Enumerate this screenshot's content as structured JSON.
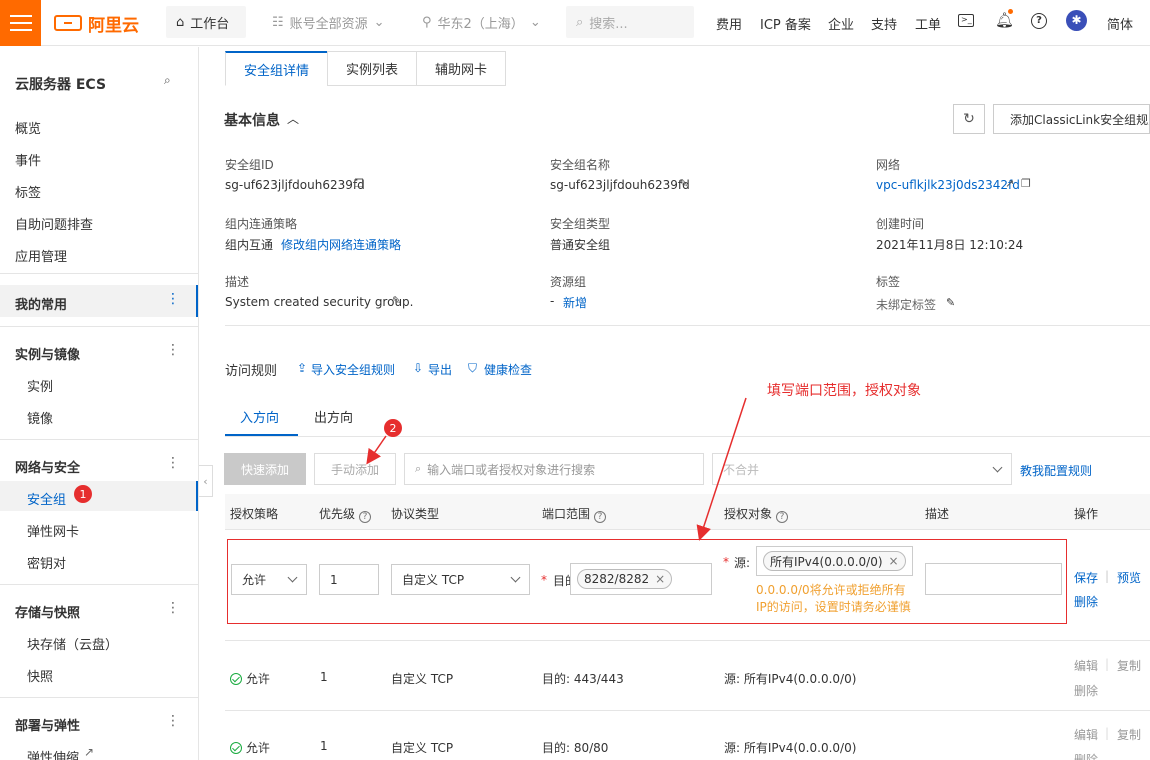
{
  "topbar": {
    "logo": "阿里云",
    "workbench": "工作台",
    "account": "账号全部资源",
    "region": "华东2（上海）",
    "search_placeholder": "搜索...",
    "nav": [
      "费用",
      "ICP 备案",
      "企业",
      "支持",
      "工单"
    ],
    "lang": "简体"
  },
  "sidebar": {
    "title": "云服务器 ECS",
    "items": [
      "概览",
      "事件",
      "标签",
      "自助问题排查",
      "应用管理"
    ],
    "favorites": "我的常用",
    "groups": [
      {
        "title": "实例与镜像",
        "items": [
          "实例",
          "镜像"
        ]
      },
      {
        "title": "网络与安全",
        "items": [
          "安全组",
          "弹性网卡",
          "密钥对"
        ]
      },
      {
        "title": "存储与快照",
        "items": [
          "块存储（云盘）",
          "快照"
        ]
      },
      {
        "title": "部署与弹性",
        "items": [
          "弹性伸缩"
        ]
      }
    ],
    "badge": "1"
  },
  "tabs": [
    "安全组详情",
    "实例列表",
    "辅助网卡"
  ],
  "basic": {
    "title": "基本信息",
    "add_classiclink": "添加ClassicLink安全组规则",
    "fields": {
      "sg_id_label": "安全组ID",
      "sg_id": "sg-uf623jljfdouh6239fd",
      "sg_name_label": "安全组名称",
      "sg_name": "sg-uf623jljfdouh6239fd",
      "network_label": "网络",
      "network": "vpc-uflkjlk23j0ds2342fd",
      "policy_label": "组内连通策略",
      "policy": "组内互通",
      "policy_link": "修改组内网络连通策略",
      "type_label": "安全组类型",
      "type": "普通安全组",
      "created_label": "创建时间",
      "created": "2021年11月8日 12:10:24",
      "desc_label": "描述",
      "desc": "System created security group.",
      "rg_label": "资源组",
      "rg": "-",
      "rg_link": "新增",
      "tags_label": "标签",
      "tags": "未绑定标签"
    }
  },
  "rules": {
    "title": "访问规则",
    "import": "导入安全组规则",
    "export": "导出",
    "health": "健康检查",
    "annotation": "填写端口范围，授权对象",
    "annotation_num": "2",
    "dir_tabs": [
      "入方向",
      "出方向"
    ],
    "quick_add": "快速添加",
    "manual_add": "手动添加",
    "search_placeholder": "输入端口或者授权对象进行搜索",
    "merge": "不合并",
    "teach": "教我配置规则",
    "headers": [
      "授权策略",
      "优先级",
      "协议类型",
      "端口范围",
      "授权对象",
      "描述",
      "操作"
    ],
    "edit_row": {
      "policy": "允许",
      "priority": "1",
      "protocol": "自定义 TCP",
      "dest_label": "目的",
      "port": "8282/8282",
      "src_label": "源:",
      "src_tag": "所有IPv4(0.0.0.0/0)",
      "warning": "0.0.0.0/0将允许或拒绝所有IP的访问，设置时请务必谨慎",
      "actions": [
        "保存",
        "预览",
        "删除"
      ]
    },
    "rows": [
      {
        "policy": "允许",
        "priority": "1",
        "protocol": "自定义 TCP",
        "port": "目的: 443/443",
        "source": "源: 所有IPv4(0.0.0.0/0)"
      },
      {
        "policy": "允许",
        "priority": "1",
        "protocol": "自定义 TCP",
        "port": "目的: 80/80",
        "source": "源: 所有IPv4(0.0.0.0/0)"
      }
    ],
    "row_actions": [
      "编辑",
      "复制",
      "删除"
    ]
  },
  "colors": {
    "brand": "#ff6a00",
    "link": "#0064c8",
    "annotation": "#e62e2e"
  }
}
